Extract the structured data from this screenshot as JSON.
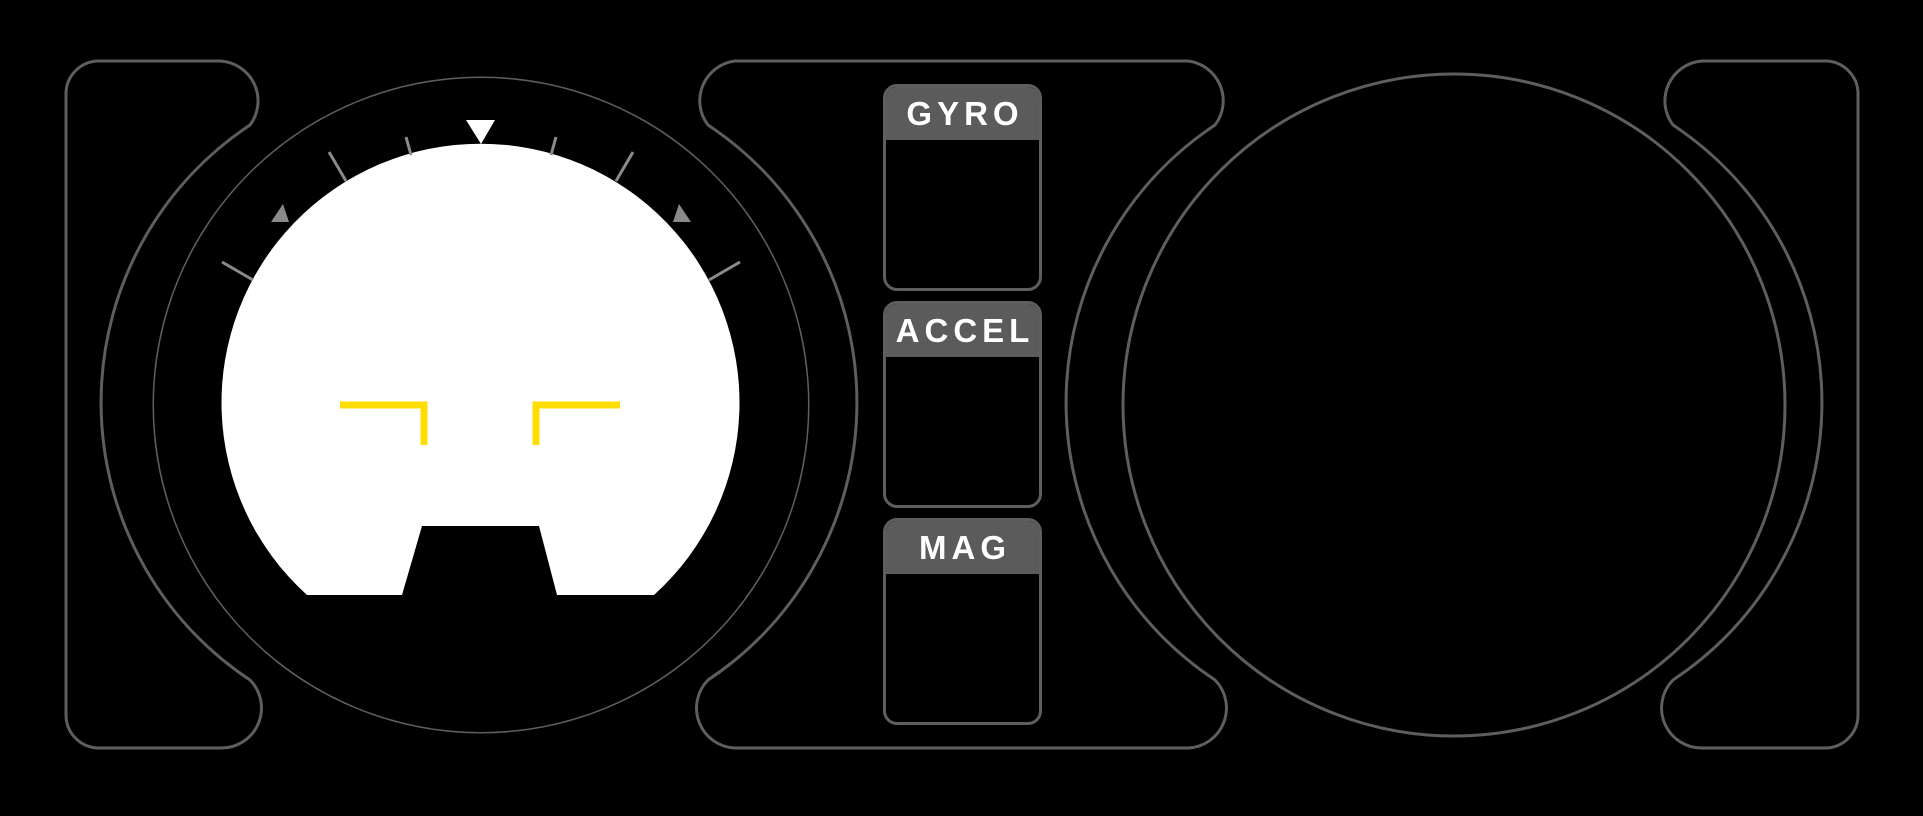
{
  "colors": {
    "background": "#000000",
    "outline": "#5e5e5e",
    "tab": "#5b5b5b",
    "sky": "#ffffff",
    "aircraft_symbol": "#ffdd00",
    "tick": "#8a8a8a"
  },
  "attitude_indicator": {
    "roll_pointer_icon": "roll-pointer-triangle",
    "aircraft_symbol_icon": "aircraft-wing-brackets"
  },
  "sensors": [
    {
      "label": "GYRO"
    },
    {
      "label": "ACCEL"
    },
    {
      "label": "MAG"
    }
  ],
  "right_indicator": {}
}
